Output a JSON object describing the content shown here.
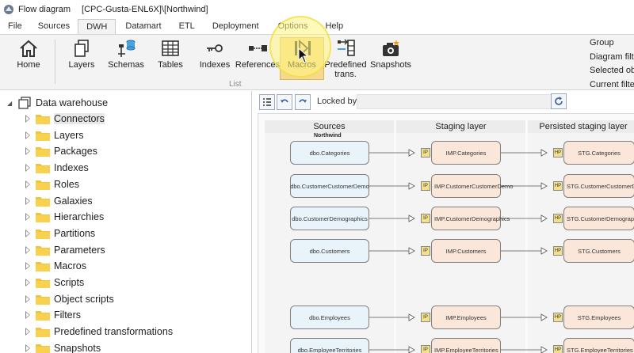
{
  "titlebar": {
    "app_name": "Flow diagram",
    "document": "[CPC-Gusta-ENL6X]\\[Northwind]"
  },
  "menu": {
    "tabs": [
      "File",
      "Sources",
      "DWH",
      "Datamart",
      "ETL",
      "Deployment",
      "Options",
      "Help"
    ],
    "active": "DWH"
  },
  "ribbon": {
    "buttons": {
      "home": "Home",
      "layers": "Layers",
      "schemas": "Schemas",
      "tables": "Tables",
      "indexes": "Indexes",
      "references": "References",
      "macros": "Macros",
      "predefined_line1": "Predefined",
      "predefined_line2": "trans.",
      "snapshots": "Snapshots"
    },
    "group_label": "List",
    "right_options": [
      "Group",
      "Diagram filter",
      "Selected object",
      "Current filter"
    ],
    "highlight_color": "#f6d98c"
  },
  "tree": {
    "root": "Data warehouse",
    "items": [
      "Connectors",
      "Layers",
      "Packages",
      "Indexes",
      "Roles",
      "Galaxies",
      "Hierarchies",
      "Partitions",
      "Parameters",
      "Macros",
      "Scripts",
      "Object scripts",
      "Filters",
      "Predefined transformations",
      "Snapshots"
    ],
    "selected": "Connectors"
  },
  "diagram": {
    "locked_by_label": "Locked by",
    "locked_by_value": "",
    "lanes": [
      "Sources",
      "Staging layer",
      "Persisted staging layer"
    ],
    "group": "Northwind",
    "rows": [
      {
        "source": "dbo.Categories",
        "staging": "IMP.Categories",
        "persisted": "STG.Categories"
      },
      {
        "source": "dbo.CustomerCustomerDemo",
        "staging": "IMP.CustomerCustomerDemo",
        "persisted": "STG.CustomerCustomerDemo"
      },
      {
        "source": "dbo.CustomerDemographics",
        "staging": "IMP.CustomerDemographics",
        "persisted": "STG.CustomerDemographics"
      },
      {
        "source": "dbo.Customers",
        "staging": "IMP.Customers",
        "persisted": "STG.Customers"
      },
      {
        "source": "dbo.Employees",
        "staging": "IMP.Employees",
        "persisted": "STG.Employees"
      },
      {
        "source": "dbo.EmployeeTerritories",
        "staging": "IMP.EmployeeTerritories",
        "persisted": "STG.EmployeeTerritories"
      }
    ],
    "staging_tag": "IP",
    "persisted_tag": "HP"
  }
}
